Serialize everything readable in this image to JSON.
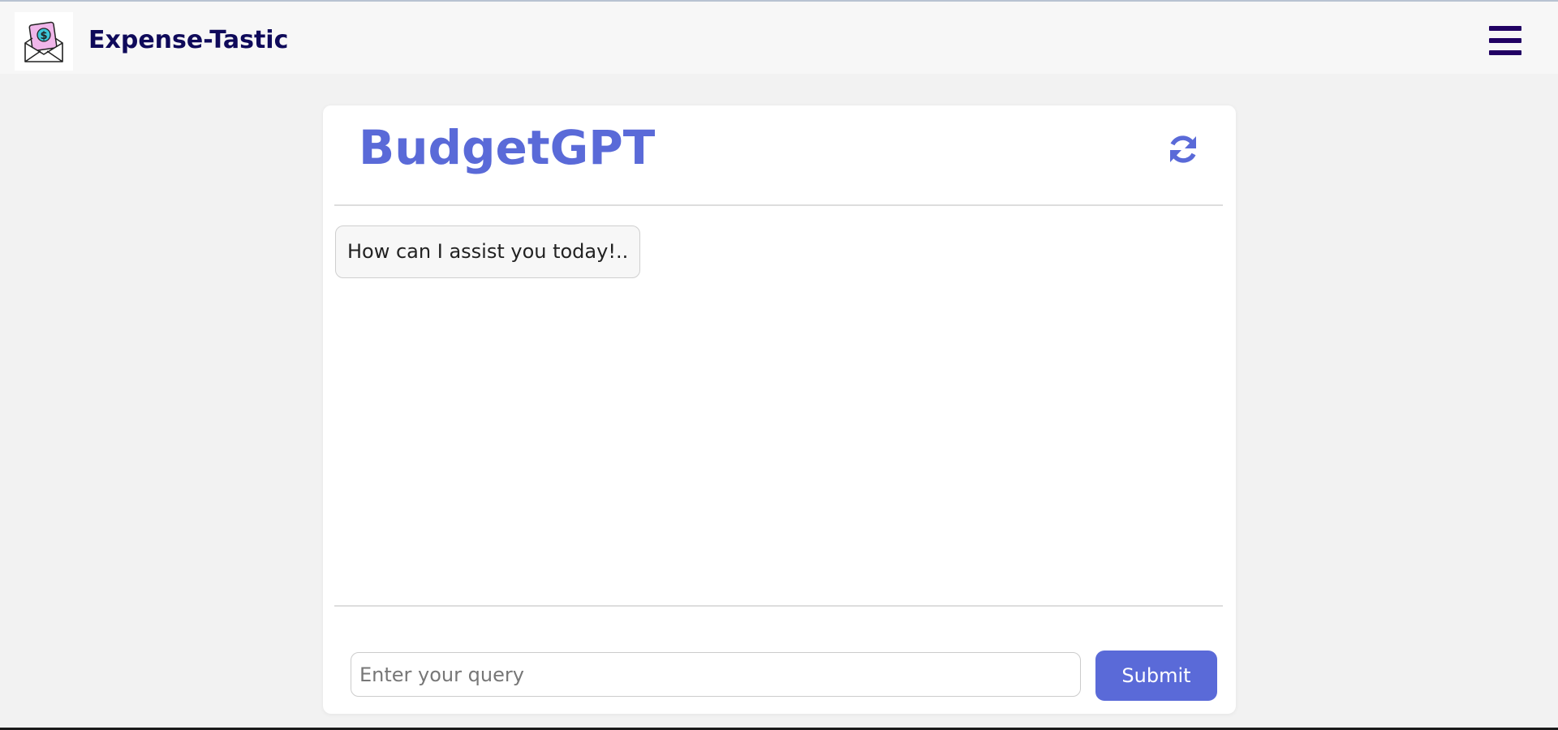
{
  "app": {
    "brand": "Expense-Tastic",
    "logo_icon": "money-envelope-icon",
    "menu_icon": "hamburger-menu-icon"
  },
  "chat": {
    "title": "BudgetGPT",
    "refresh_icon": "refresh-icon",
    "messages": [
      {
        "from": "bot",
        "text": "How can I assist you today!.."
      }
    ],
    "input_placeholder": "Enter your query",
    "input_value": "",
    "submit_label": "Submit"
  },
  "colors": {
    "accent": "#5a6ad8",
    "brand_text": "#0f0a5a",
    "menu_icon": "#210063",
    "page_bg": "#f2f2f2",
    "navbar_bg": "#f7f7f7"
  }
}
